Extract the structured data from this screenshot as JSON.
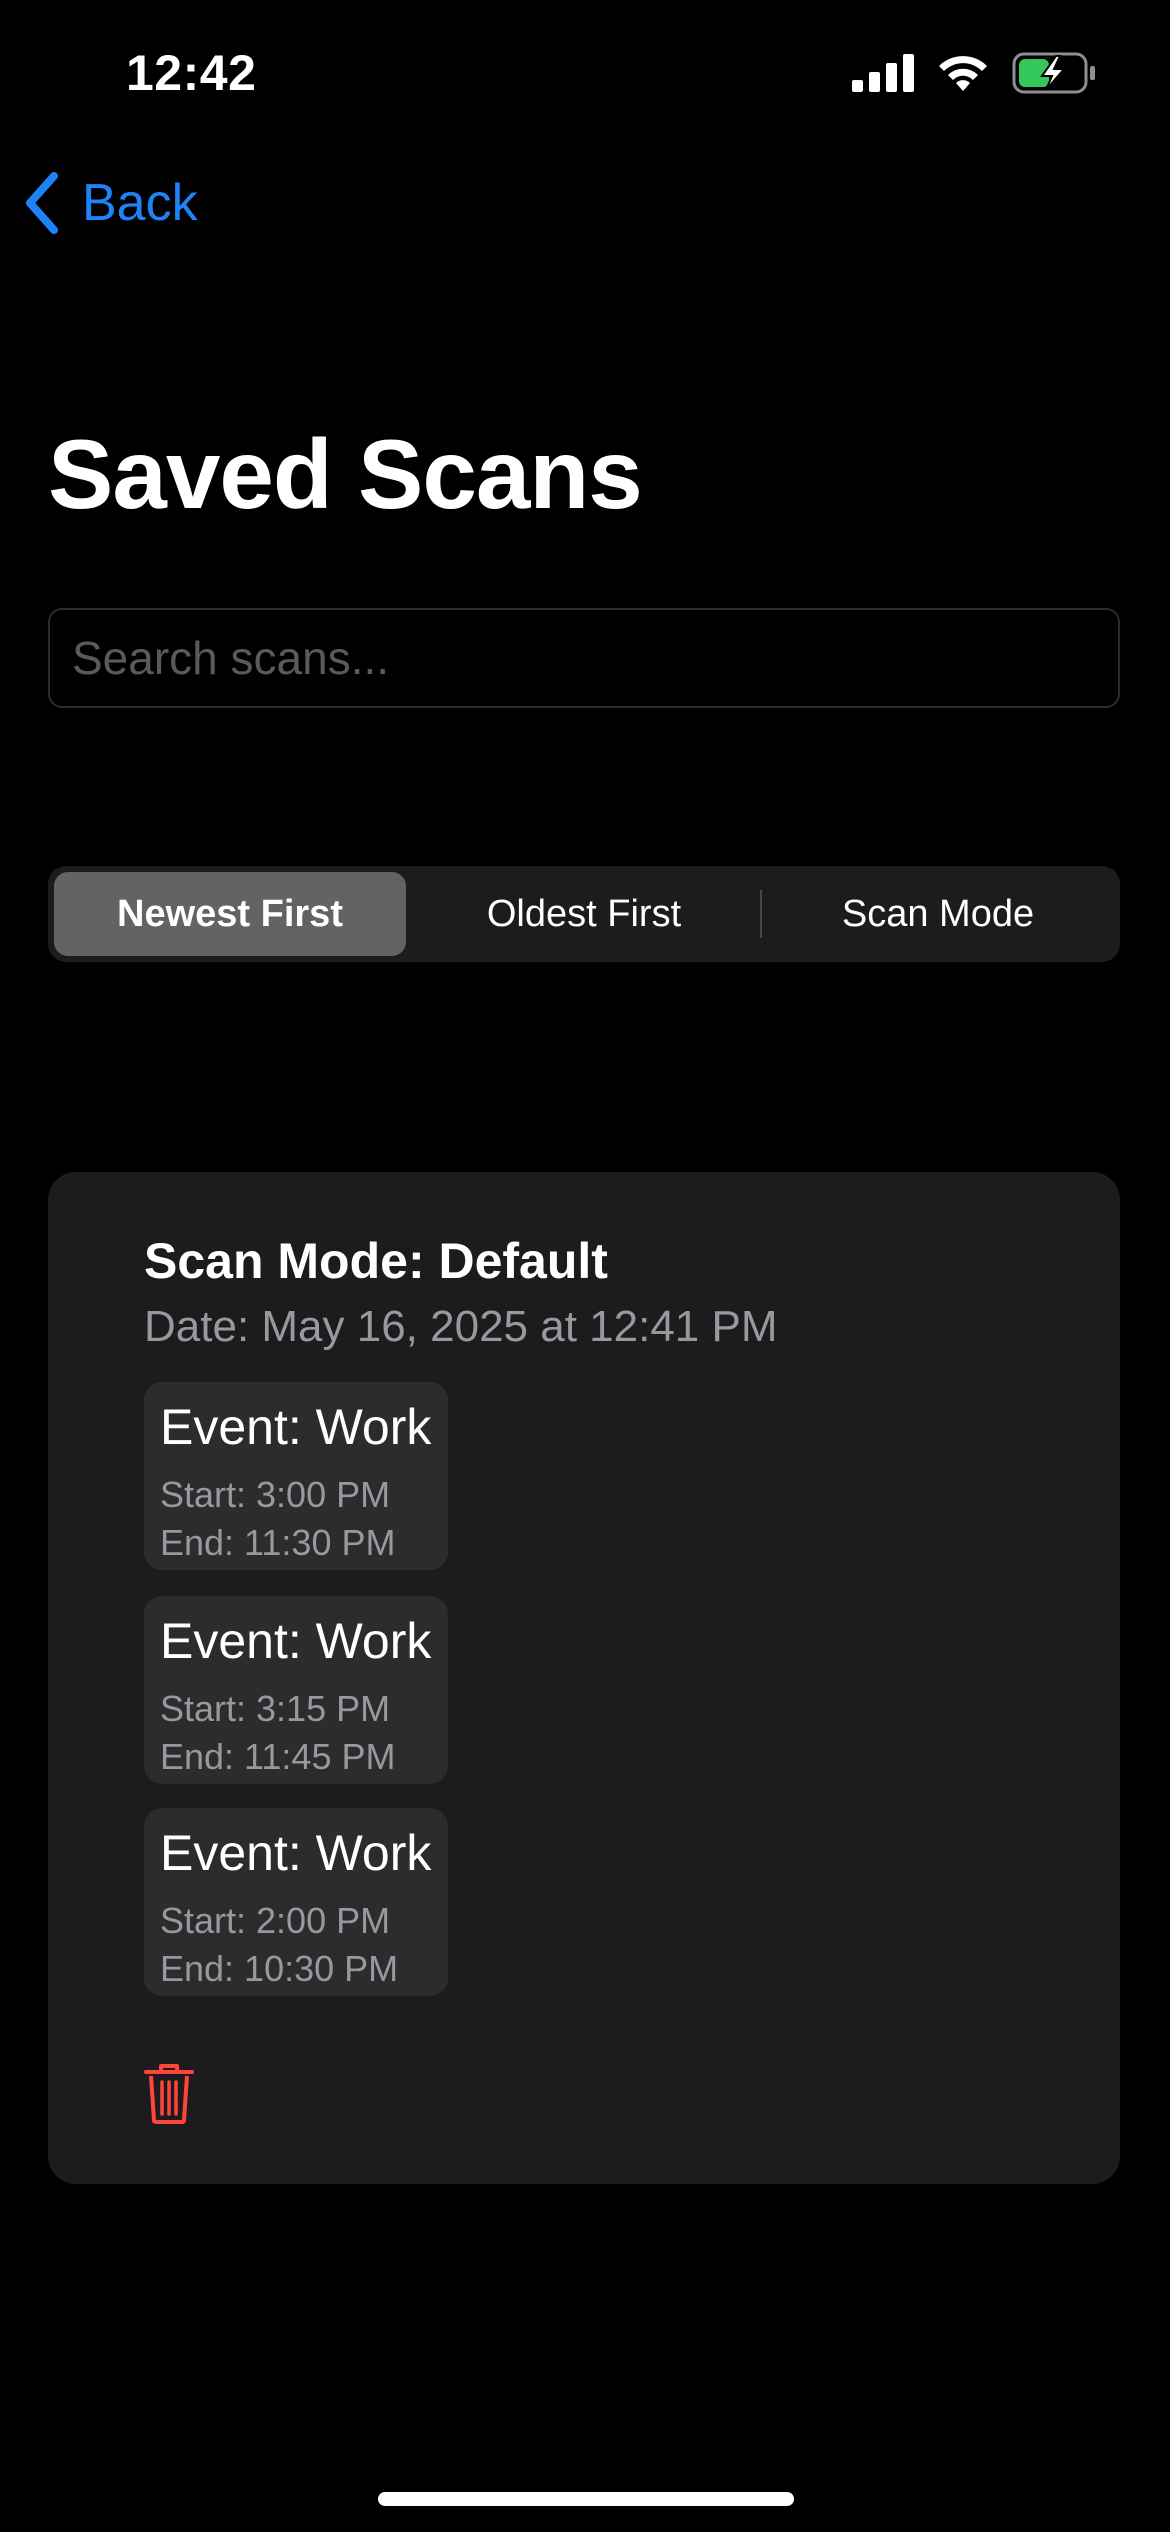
{
  "status_bar": {
    "time": "12:42"
  },
  "nav": {
    "back_label": "Back",
    "accent_color": "#1e83f7"
  },
  "page": {
    "title": "Saved Scans"
  },
  "search": {
    "placeholder": "Search scans...",
    "value": ""
  },
  "sort": {
    "options": [
      "Newest First",
      "Oldest First",
      "Scan Mode"
    ],
    "selected": "Newest First"
  },
  "scan": {
    "title": "Scan Mode: Default",
    "date": "Date: May 16, 2025 at 12:41 PM",
    "events": [
      {
        "name": "Event: Work",
        "start": "Start: 3:00 PM",
        "end": "End: 11:30 PM"
      },
      {
        "name": "Event: Work",
        "start": "Start: 3:15 PM",
        "end": "End: 11:45 PM"
      },
      {
        "name": "Event: Work",
        "start": "Start: 2:00 PM",
        "end": "End: 10:30 PM"
      }
    ],
    "delete_icon": "trash-icon",
    "delete_color": "#ff453a"
  }
}
